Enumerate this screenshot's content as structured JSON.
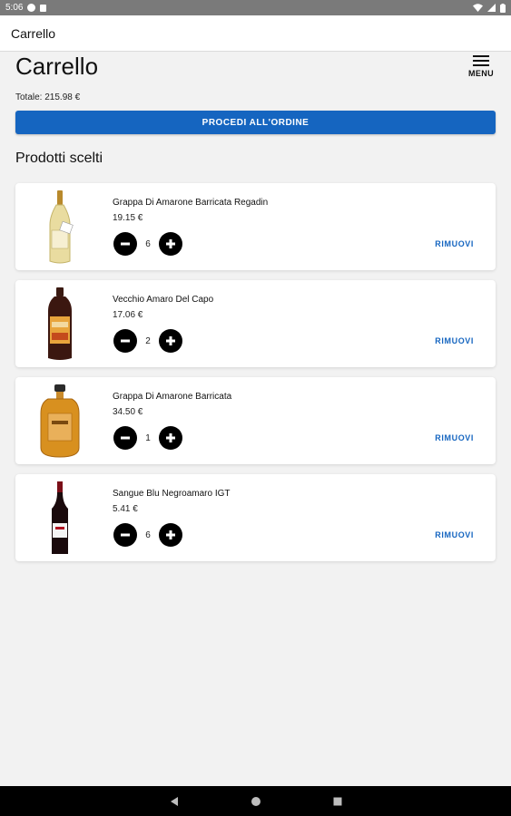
{
  "status_bar": {
    "time": "5:06"
  },
  "appbar": {
    "title": "Carrello"
  },
  "page": {
    "title": "Carrello",
    "menu_label": "MENU"
  },
  "cart": {
    "total_text": "Totale: 215.98 €",
    "order_button": "PROCEDI ALL'ORDINE",
    "section_title": "Prodotti scelti",
    "remove_label": "RIMUOVI",
    "items": [
      {
        "name": "Grappa Di Amarone Barricata Regadin",
        "price": "19.15 €",
        "qty": "6"
      },
      {
        "name": "Vecchio Amaro Del Capo",
        "price": "17.06 €",
        "qty": "2"
      },
      {
        "name": "Grappa Di Amarone Barricata",
        "price": "34.50 €",
        "qty": "1"
      },
      {
        "name": "Sangue Blu Negroamaro IGT",
        "price": "5.41 €",
        "qty": "6"
      }
    ]
  },
  "colors": {
    "accent": "#1565c0",
    "background": "#f2f2f2"
  }
}
